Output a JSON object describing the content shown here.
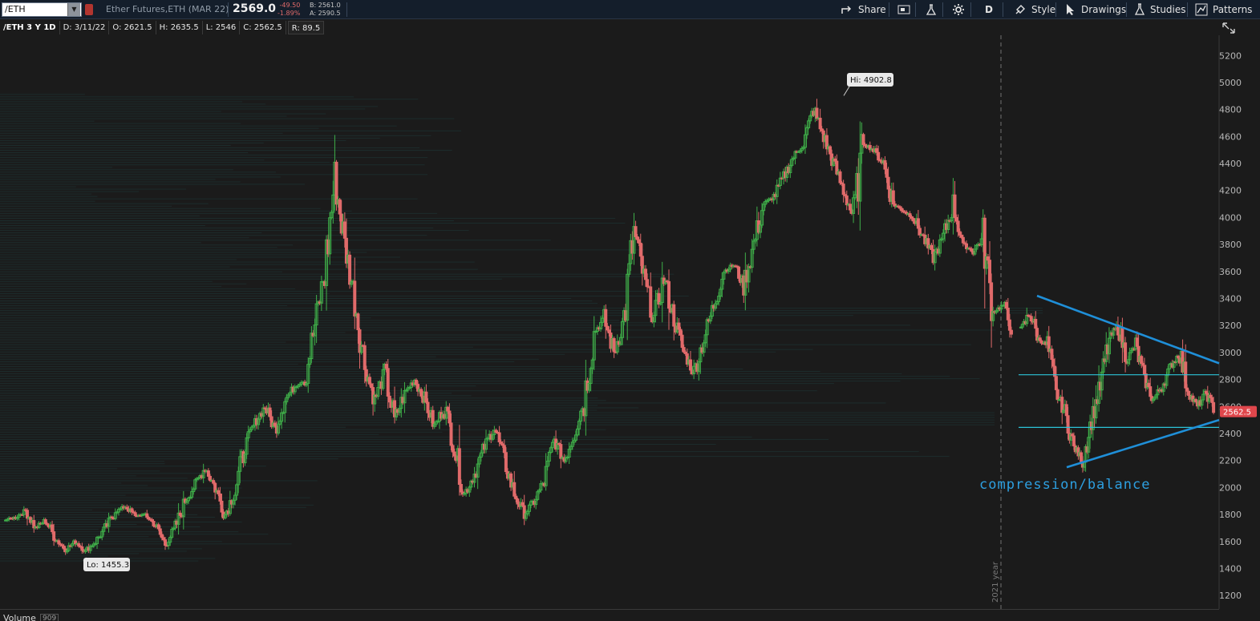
{
  "toolbar": {
    "symbol": "/ETH",
    "description": "Ether Futures,ETH (MAR 22)",
    "last_price": "2569.0",
    "net_change": "-49.50",
    "pct_change": "-1.89%",
    "bid": "B: 2561.0",
    "ask": "A: 2590.5",
    "share_label": "Share",
    "period_label": "D",
    "style_label": "Style",
    "drawings_label": "Drawings",
    "studies_label": "Studies",
    "patterns_label": "Patterns"
  },
  "info": {
    "symbol_period": "/ETH 3 Y 1D",
    "date": "D: 3/11/22",
    "open": "O: 2621.5",
    "high": "H: 2635.5",
    "low": "L: 2546",
    "close": "C: 2562.5",
    "range": "R: 89.5"
  },
  "volume": {
    "label": "Volume",
    "value": "909"
  },
  "colors": {
    "up": "#3fae49",
    "down": "#e06a6a",
    "trendline": "#1f8fd8",
    "hline": "#2cc3d8",
    "profile": "#1e3a3a",
    "annotation": "#2d9fe0",
    "price_tag": "#e0474c"
  },
  "chart_data": {
    "type": "candlestick",
    "title": "/ETH 3 Y 1D",
    "ylim": [
      1100,
      5350
    ],
    "yticks": [
      1200,
      1400,
      1600,
      1800,
      2000,
      2200,
      2400,
      2600,
      2800,
      3000,
      3200,
      3400,
      3600,
      3800,
      4000,
      4200,
      4400,
      4600,
      4800,
      5000,
      5200
    ],
    "grid": false,
    "year_marker": "2021 year",
    "annotations": {
      "high_label": "Hi: 4902.8",
      "low_label": "Lo: 1455.3",
      "text": "compression/balance",
      "last_price_tag": "2562.5"
    },
    "points": [
      1760,
      1780,
      1830,
      1700,
      1760,
      1620,
      1540,
      1600,
      1530,
      1600,
      1700,
      1820,
      1860,
      1790,
      1800,
      1720,
      1580,
      1700,
      1900,
      2020,
      2150,
      2000,
      1800,
      1980,
      2300,
      2480,
      2600,
      2430,
      2650,
      2750,
      2800,
      3200,
      3600,
      4300,
      3800,
      3400,
      2900,
      2650,
      2850,
      2500,
      2700,
      2800,
      2650,
      2450,
      2600,
      2300,
      1950,
      2100,
      2300,
      2450,
      2200,
      1950,
      1800,
      1900,
      2050,
      2350,
      2200,
      2400,
      2650,
      3150,
      3250,
      3000,
      3250,
      3900,
      3550,
      3250,
      3550,
      3250,
      3000,
      2850,
      3100,
      3350,
      3600,
      3650,
      3500,
      3800,
      4100,
      4150,
      4300,
      4450,
      4550,
      4800,
      4600,
      4400,
      4200,
      4000,
      4550,
      4500,
      4400,
      4100,
      4050,
      4000,
      3850,
      3700,
      3850,
      4100,
      3800,
      3750,
      3850,
      3300,
      3350,
      3150,
      3300,
      3100,
      3050,
      2700,
      2550,
      2300,
      2200,
      2500,
      2750,
      3100,
      3200,
      2950,
      3050,
      2800,
      2650,
      2750,
      2900,
      3000,
      2700,
      2600,
      2700,
      2562.5
    ],
    "trendlines": [
      {
        "from": [
          1293,
          3420
        ],
        "to": [
          1520,
          2920
        ]
      },
      {
        "from": [
          1330,
          2150
        ],
        "to": [
          1520,
          2500
        ]
      }
    ],
    "hlines": [
      {
        "y": 2835,
        "x_from": 1270,
        "x_to": 1520
      },
      {
        "y": 2445,
        "x_from": 1270,
        "x_to": 1520
      }
    ]
  }
}
